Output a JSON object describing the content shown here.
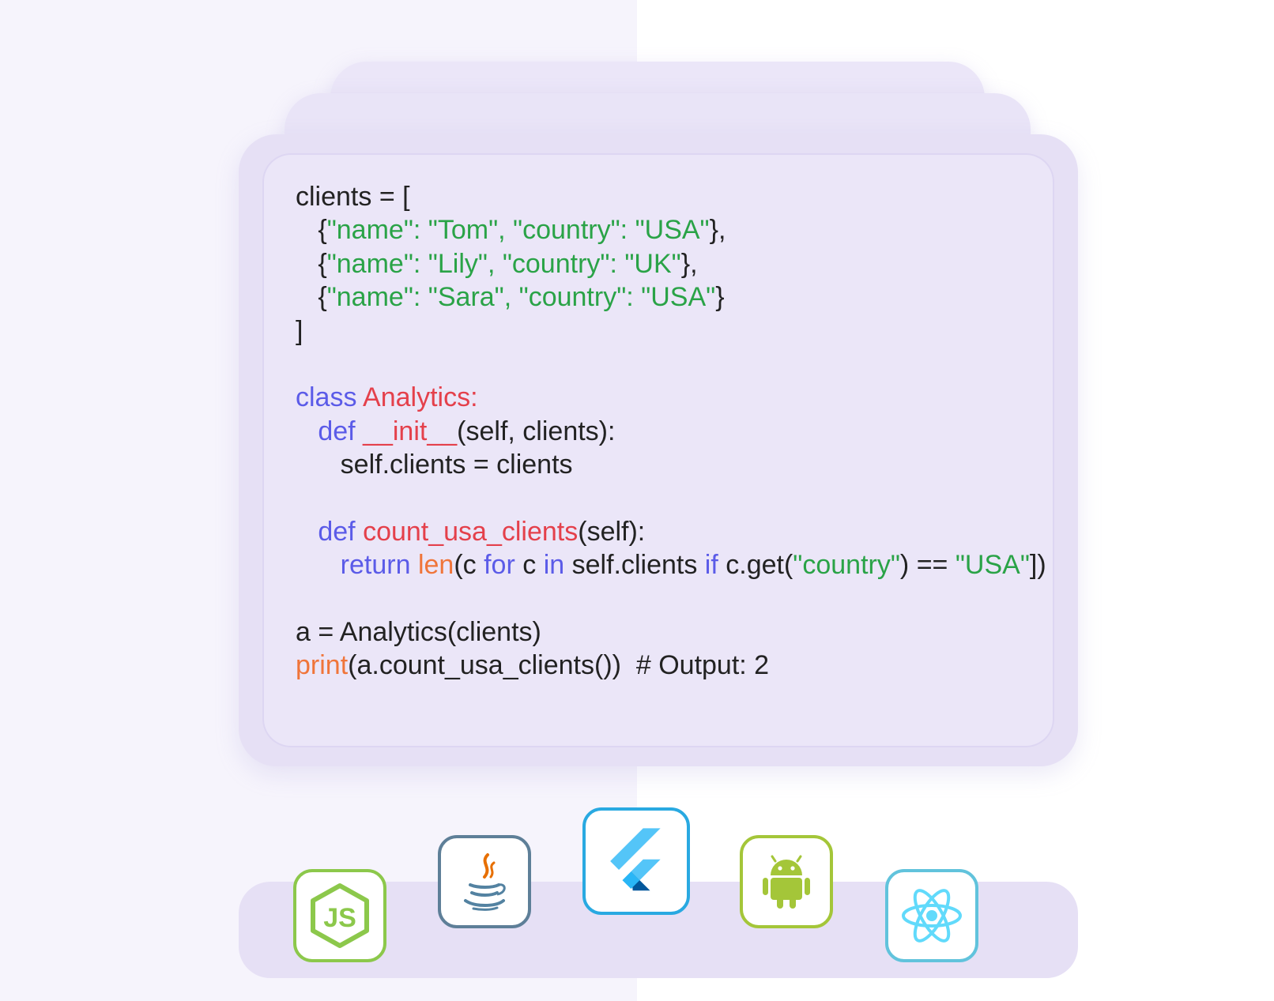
{
  "code": {
    "lines": [
      [
        {
          "t": "clients = [",
          "c": "plain"
        }
      ],
      [
        {
          "t": "   {",
          "c": "plain"
        },
        {
          "t": "\"name\": \"Tom\", \"country\": \"USA\"",
          "c": "str"
        },
        {
          "t": "},",
          "c": "plain"
        }
      ],
      [
        {
          "t": "   {",
          "c": "plain"
        },
        {
          "t": "\"name\": \"Lily\", \"country\": \"UK\"",
          "c": "str"
        },
        {
          "t": "},",
          "c": "plain"
        }
      ],
      [
        {
          "t": "   {",
          "c": "plain"
        },
        {
          "t": "\"name\": \"Sara\", \"country\": \"USA\"",
          "c": "str"
        },
        {
          "t": "}",
          "c": "plain"
        }
      ],
      [
        {
          "t": "]",
          "c": "plain"
        }
      ],
      [],
      [
        {
          "t": "class ",
          "c": "kw"
        },
        {
          "t": "Analytics:",
          "c": "cls"
        }
      ],
      [
        {
          "t": "   def ",
          "c": "kw"
        },
        {
          "t": "__init__",
          "c": "cls"
        },
        {
          "t": "(self, clients):",
          "c": "plain"
        }
      ],
      [
        {
          "t": "      self.clients = clients",
          "c": "plain"
        }
      ],
      [],
      [
        {
          "t": "   def ",
          "c": "kw"
        },
        {
          "t": "count_usa_clients",
          "c": "cls"
        },
        {
          "t": "(self):",
          "c": "plain"
        }
      ],
      [
        {
          "t": "      return ",
          "c": "kw"
        },
        {
          "t": "len",
          "c": "bi"
        },
        {
          "t": "(c ",
          "c": "plain"
        },
        {
          "t": "for",
          "c": "kw"
        },
        {
          "t": " c ",
          "c": "plain"
        },
        {
          "t": "in",
          "c": "kw"
        },
        {
          "t": " self.clients ",
          "c": "plain"
        },
        {
          "t": "if",
          "c": "kw"
        },
        {
          "t": " c.get(",
          "c": "plain"
        },
        {
          "t": "\"country\"",
          "c": "str"
        },
        {
          "t": ") == ",
          "c": "plain"
        },
        {
          "t": "\"USA\"",
          "c": "str"
        },
        {
          "t": "])",
          "c": "plain"
        }
      ],
      [],
      [
        {
          "t": "a = Analytics(clients)",
          "c": "plain"
        }
      ],
      [
        {
          "t": "print",
          "c": "bi"
        },
        {
          "t": "(a.count_usa_clients())  # Output: 2",
          "c": "plain"
        }
      ]
    ]
  },
  "colors": {
    "keyword": "#5b5be8",
    "class_name": "#e4404b",
    "string": "#2aa347",
    "builtin": "#f0753a",
    "text": "#222222",
    "card": "#e6e0f5"
  },
  "tech_icons": [
    {
      "name": "nodejs-icon",
      "label": "JS",
      "border": "#8cc84b"
    },
    {
      "name": "java-icon",
      "border": "#5e7f98"
    },
    {
      "name": "flutter-icon",
      "border": "#29a9e1"
    },
    {
      "name": "android-icon",
      "border": "#a4c639"
    },
    {
      "name": "react-icon",
      "border": "#61c3dc"
    }
  ]
}
